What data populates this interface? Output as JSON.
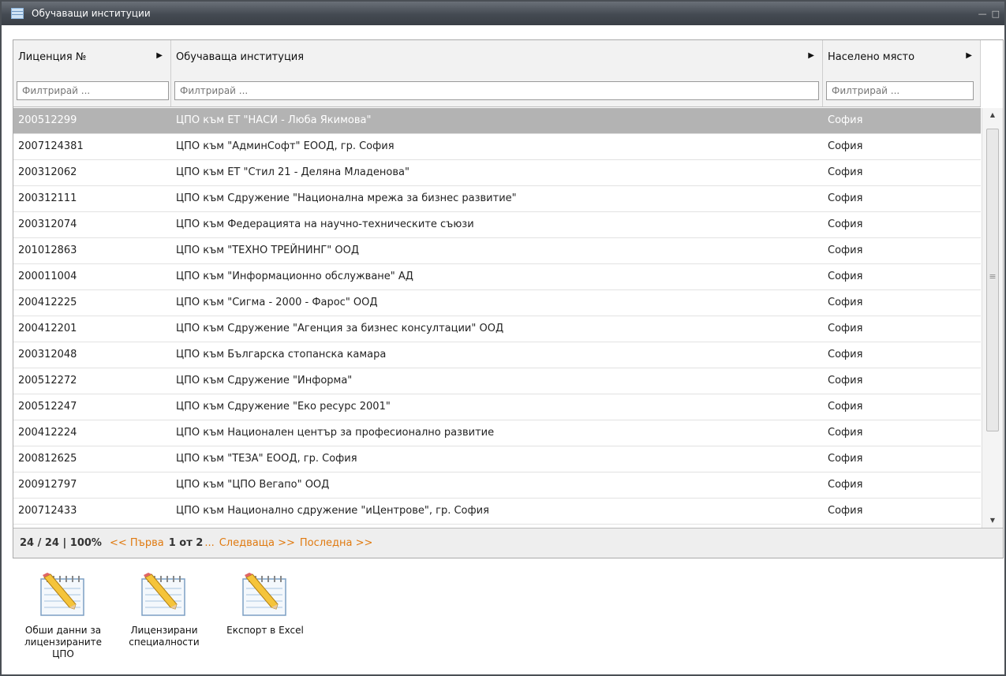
{
  "window": {
    "title": "Обучаващи институции"
  },
  "columns": [
    {
      "title": "Лиценция №",
      "filter_placeholder": "Филтрирай ..."
    },
    {
      "title": "Обучаваща институция",
      "filter_placeholder": "Филтрирай ..."
    },
    {
      "title": "Населено място",
      "filter_placeholder": "Филтрирай ..."
    }
  ],
  "rows": [
    {
      "license": "200512299",
      "institution": "ЦПО към ЕТ \"НАСИ - Люба Якимова\"",
      "city": "София"
    },
    {
      "license": "2007124381",
      "institution": "ЦПО към \"АдминСофт\" ЕООД, гр. София",
      "city": "София"
    },
    {
      "license": "200312062",
      "institution": "ЦПО към ЕТ \"Стил 21 - Деляна Младенова\"",
      "city": "София"
    },
    {
      "license": "200312111",
      "institution": "ЦПО към Сдружение \"Национална мрежа за бизнес развитие\"",
      "city": "София"
    },
    {
      "license": "200312074",
      "institution": "ЦПО към Федерацията на научно-техническите съюзи",
      "city": "София"
    },
    {
      "license": "201012863",
      "institution": "ЦПО към \"ТЕХНО ТРЕЙНИНГ\" ООД",
      "city": "София"
    },
    {
      "license": "200011004",
      "institution": "ЦПО към \"Информационно обслужване\" АД",
      "city": "София"
    },
    {
      "license": "200412225",
      "institution": "ЦПО към \"Сигма - 2000 - Фарос\" ООД",
      "city": "София"
    },
    {
      "license": "200412201",
      "institution": "ЦПО към Сдружение \"Агенция за бизнес консултации\" ООД",
      "city": "София"
    },
    {
      "license": "200312048",
      "institution": "ЦПО към Българска стопанска камара",
      "city": "София"
    },
    {
      "license": "200512272",
      "institution": "ЦПО към Сдружение \"Информа\"",
      "city": "София"
    },
    {
      "license": "200512247",
      "institution": "ЦПО към Сдружение \"Еко ресурс 2001\"",
      "city": "София"
    },
    {
      "license": "200412224",
      "institution": "ЦПО към Национален център за професионално развитие",
      "city": "София"
    },
    {
      "license": "200812625",
      "institution": "ЦПО към \"ТЕЗА\" ЕООД, гр. София",
      "city": "София"
    },
    {
      "license": "200912797",
      "institution": "ЦПО към \"ЦПО Вегапо\" ООД",
      "city": "София"
    },
    {
      "license": "200712433",
      "institution": "ЦПО към Национално сдружение \"иЦентрове\", гр. София",
      "city": "София"
    }
  ],
  "pager": {
    "count": "24 / 24 | 100%",
    "first": "<< Първа",
    "current": "1 от 2",
    "ellipsis": "...",
    "next": "Следваща >>",
    "last": "Последна >>"
  },
  "actions": [
    {
      "label": "Обши данни за\nлицензираните\nЦПО",
      "icon": "notepad-pencil-icon"
    },
    {
      "label": "Лицензирани\nспециалности",
      "icon": "notepad-pencil-icon"
    },
    {
      "label": "Експорт в Excel",
      "icon": "notepad-pencil-icon"
    }
  ]
}
